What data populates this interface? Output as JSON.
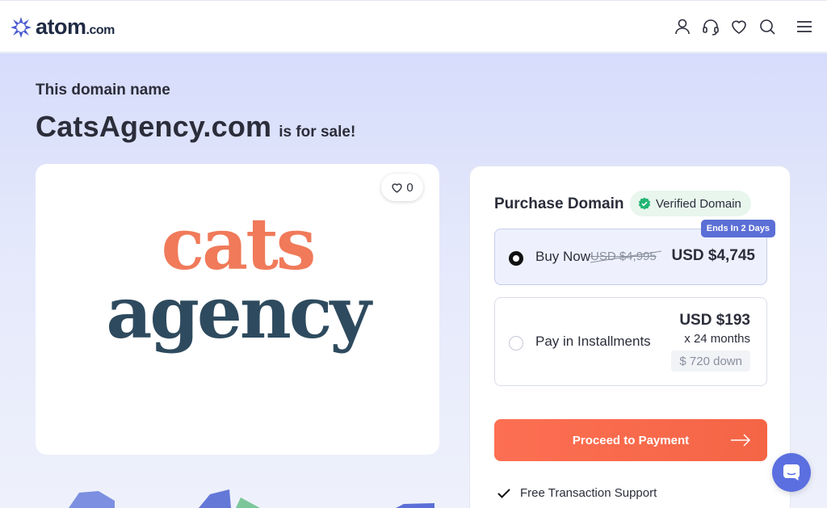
{
  "header": {
    "logo_text": "atom",
    "logo_suffix": ".com",
    "icons": [
      "user-icon",
      "headset-icon",
      "heart-icon",
      "search-icon",
      "menu-icon"
    ]
  },
  "hero": {
    "kicker": "This domain name",
    "domain": "CatsAgency.com",
    "for_sale": "is for sale!"
  },
  "logo_card": {
    "likes": "0",
    "brand_line1": "cats",
    "brand_line2": "agency"
  },
  "purchase": {
    "title": "Purchase Domain",
    "verified_label": "Verified Domain",
    "buy_now": {
      "label": "Buy Now",
      "old_price": "USD $4,995",
      "price": "USD $4,745",
      "badge": "Ends In 2 Days",
      "selected": true
    },
    "installments": {
      "label": "Pay in Installments",
      "price": "USD $193",
      "term": "x 24 months",
      "down": "$ 720 down",
      "selected": false
    },
    "proceed_label": "Proceed to Payment",
    "support_label": "Free Transaction Support"
  },
  "colors": {
    "accent": "#fd6f52",
    "brand_blue": "#5b6fd6",
    "cats_orange": "#f07a5a",
    "agency_navy": "#2e4a5e",
    "verified_green": "#22b573"
  }
}
